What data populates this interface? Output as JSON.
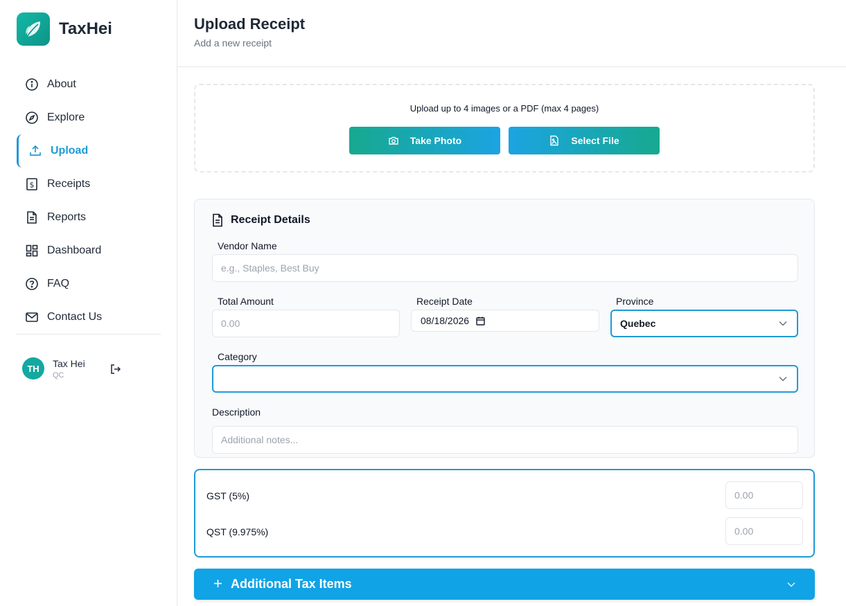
{
  "brand": {
    "name": "TaxHei",
    "logo_icon": "leaf-icon",
    "accent": "#14b8a6"
  },
  "nav": [
    {
      "label": "About",
      "icon": "info-icon"
    },
    {
      "label": "Explore",
      "icon": "compass-icon"
    },
    {
      "label": "Upload",
      "icon": "upload-icon",
      "active": true
    },
    {
      "label": "Receipts",
      "icon": "receipt-dollar-icon"
    },
    {
      "label": "Reports",
      "icon": "document-icon"
    },
    {
      "label": "Dashboard",
      "icon": "dashboard-grid-icon"
    },
    {
      "label": "FAQ",
      "icon": "help-icon"
    },
    {
      "label": "Contact Us",
      "icon": "mail-icon"
    }
  ],
  "user": {
    "initials": "TH",
    "name": "Tax Hei",
    "province": "QC"
  },
  "header": {
    "title": "Upload Receipt",
    "subtitle": "Add a new receipt"
  },
  "upload": {
    "instructions": "Upload up to 4 images or a PDF (max 4 pages)",
    "take_photo": "Take Photo",
    "select_file": "Select File"
  },
  "details": {
    "title": "Receipt Details",
    "vendor_label": "Vendor Name",
    "vendor_placeholder": "e.g., Staples, Best Buy",
    "total_label": "Total Amount",
    "total_placeholder": "0.00",
    "date_label": "Receipt Date",
    "date_value": "08/18/2026",
    "province_label": "Province",
    "province_value": "Quebec",
    "category_label": "Category",
    "category_value": "",
    "description_label": "Description",
    "description_placeholder": "Additional notes..."
  },
  "taxes": [
    {
      "label": "GST (5%)",
      "placeholder": "0.00"
    },
    {
      "label": "QST (9.975%)",
      "placeholder": "0.00"
    }
  ],
  "additional": {
    "label": "Additional Tax Items",
    "color": "#10a3e6"
  }
}
